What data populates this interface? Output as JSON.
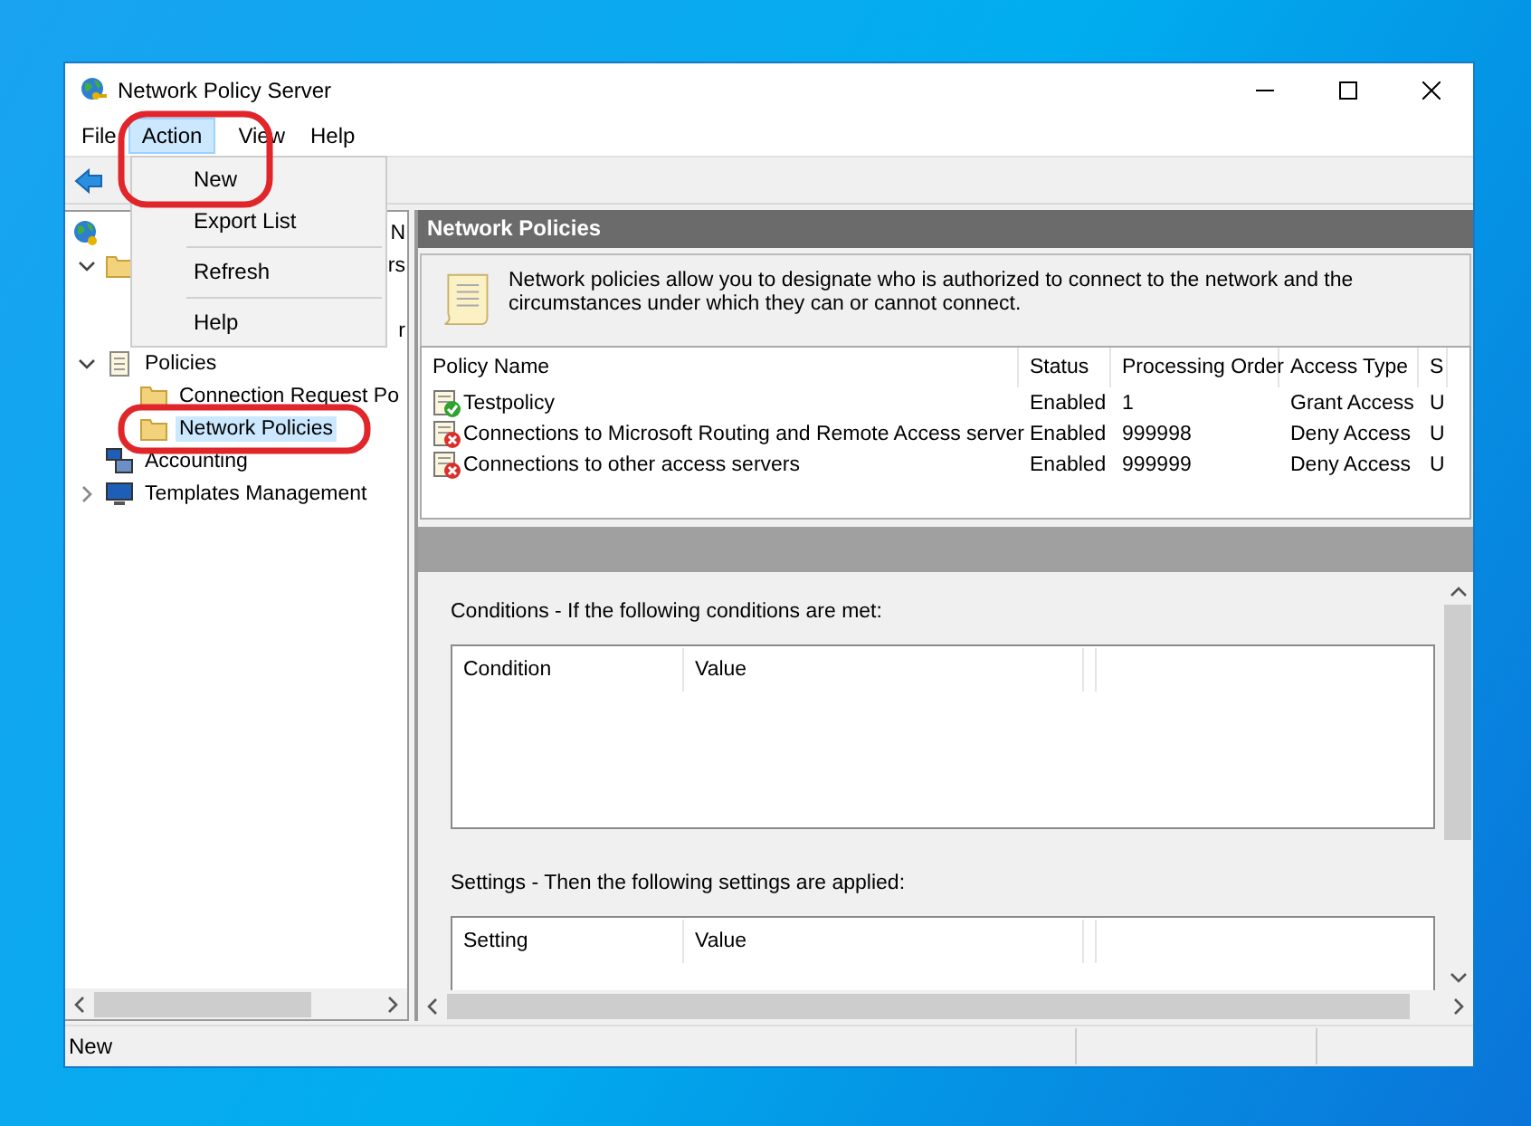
{
  "window": {
    "title": "Network Policy Server"
  },
  "menubar": [
    {
      "label": "File",
      "selected": false
    },
    {
      "label": "Action",
      "selected": true
    },
    {
      "label": "View",
      "selected": false
    },
    {
      "label": "Help",
      "selected": false
    }
  ],
  "dropdown": [
    {
      "kind": "item",
      "label": "New"
    },
    {
      "kind": "item",
      "label": "Export List"
    },
    {
      "kind": "separator"
    },
    {
      "kind": "item",
      "label": "Refresh"
    },
    {
      "kind": "separator"
    },
    {
      "kind": "item",
      "label": "Help"
    }
  ],
  "tree": [
    {
      "label": "N",
      "kind": "partial",
      "selected": false,
      "children": [
        {
          "label": "rs",
          "kind": "partial",
          "expanded": true,
          "selected": false,
          "children": [
            {
              "label": "r",
              "kind": "partial",
              "selected": false
            }
          ]
        },
        {
          "label": "Policies",
          "kind": "full",
          "expanded": true,
          "selected": false,
          "children": [
            {
              "label": "Connection Request Po",
              "kind": "full",
              "selected": false
            },
            {
              "label": "Network Policies",
              "kind": "full",
              "selected": true
            }
          ]
        },
        {
          "label": "Accounting",
          "kind": "full",
          "selected": false
        },
        {
          "label": "Templates Management",
          "kind": "full",
          "expanded": false,
          "selected": false
        }
      ]
    }
  ],
  "panel": {
    "title": "Network Policies",
    "description": "Network policies allow you to designate who is authorized to connect to the network and the circumstances under which they can or cannot connect."
  },
  "policies": {
    "columns": [
      "Policy Name",
      "Status",
      "Processing Order",
      "Access Type",
      "S"
    ],
    "rows": [
      {
        "name": "Testpolicy",
        "status": "Enabled",
        "order": "1",
        "access": "Grant Access",
        "source": "U",
        "kind": "grant"
      },
      {
        "name": "Connections to Microsoft Routing and Remote Access server",
        "status": "Enabled",
        "order": "999998",
        "access": "Deny Access",
        "source": "U",
        "kind": "deny"
      },
      {
        "name": "Connections to other access servers",
        "status": "Enabled",
        "order": "999999",
        "access": "Deny Access",
        "source": "U",
        "kind": "deny"
      }
    ]
  },
  "conditions": {
    "heading": "Conditions - If the following conditions are met:",
    "columns": [
      "Condition",
      "Value"
    ]
  },
  "settings": {
    "heading": "Settings - Then the following settings are applied:",
    "columns": [
      "Setting",
      "Value"
    ]
  },
  "status_bar": {
    "text": "New"
  }
}
